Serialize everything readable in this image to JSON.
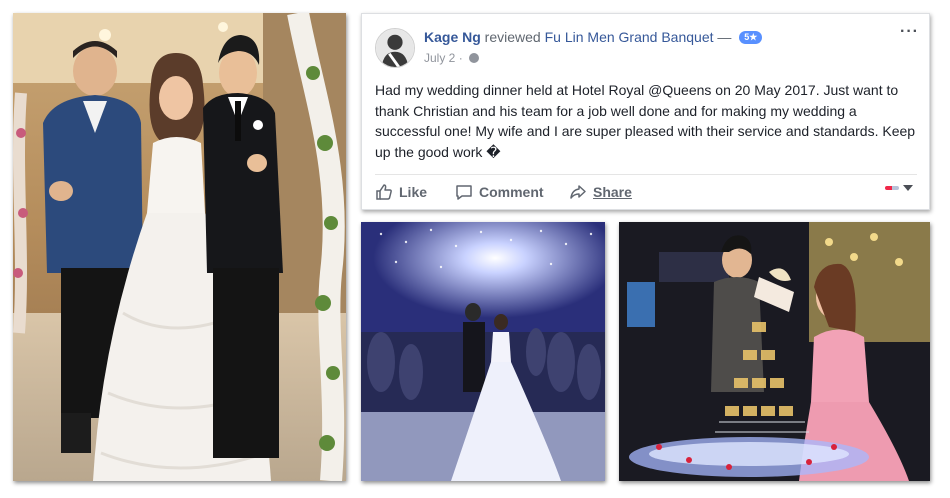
{
  "review": {
    "reviewer_name": "Kage Ng",
    "action_text": " reviewed ",
    "page_name": "Fu Lin Men Grand Banquet",
    "separator": " — ",
    "rating_badge": "5★",
    "date": "July 2",
    "dot": " · ",
    "more_menu": "···",
    "text": "Had my wedding dinner held at Hotel Royal @Queens on 20 May 2017. Just want to thank Christian and his team for a job well done and for making my wedding a successful one! My wife and I are super pleased with their service and standards. Keep up the good work �"
  },
  "actions": {
    "like_label": "Like",
    "comment_label": "Comment",
    "share_label": "Share"
  },
  "photos": [
    {
      "name": "wedding-group-photo",
      "icon": "photo-couple-with-guest"
    },
    {
      "name": "wedding-march-photo",
      "icon": "photo-couple-walking-hall"
    },
    {
      "name": "champagne-tower-photo",
      "icon": "photo-champagne-tower"
    }
  ],
  "colors": {
    "link": "#365899",
    "muted": "#90949c",
    "text": "#1d2129",
    "badge": "#5890ff",
    "action": "#616770"
  }
}
